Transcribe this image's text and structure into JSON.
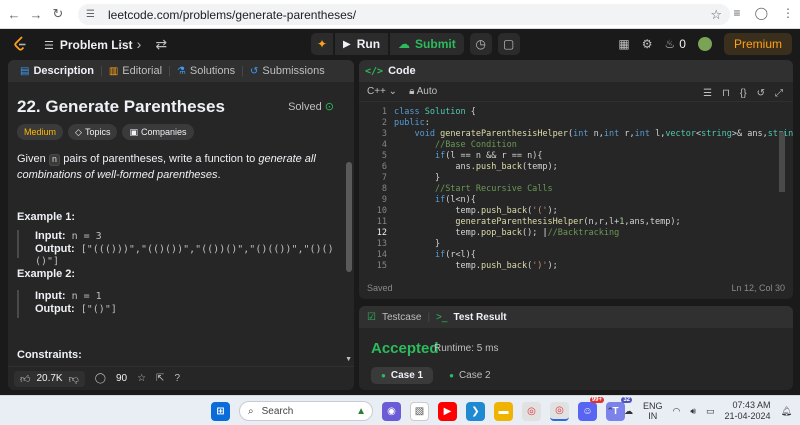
{
  "browser": {
    "url": "leetcode.com/problems/generate-parentheses/"
  },
  "topbar": {
    "problem_list": "Problem List",
    "run": "Run",
    "submit": "Submit",
    "coins": "0",
    "premium": "Premium"
  },
  "left": {
    "tabs": [
      "Description",
      "Editorial",
      "Solutions",
      "Submissions"
    ],
    "title": "22. Generate Parentheses",
    "solved": "Solved",
    "chips": [
      "Medium",
      "Topics",
      "Companies"
    ],
    "desc_pre": "Given ",
    "desc_code": "n",
    "desc_mid": " pairs of parentheses, write a function to ",
    "desc_em": "generate all combinations of well-formed parentheses",
    "desc_post": ".",
    "example1": {
      "heading": "Example 1:",
      "input_label": "Input:",
      "input_value": "n = 3",
      "output_label": "Output:",
      "output_value": "[\"((()))\",\"(()())\",\"(())()\",\"()(())\",\"()()()\"]"
    },
    "example2": {
      "heading": "Example 2:",
      "input_label": "Input:",
      "input_value": "n = 1",
      "output_label": "Output:",
      "output_value": "[\"()\"]"
    },
    "constraints": "Constraints:",
    "likes": "20.7K",
    "comments": "90"
  },
  "code": {
    "title": "Code",
    "language": "C++",
    "auto": "Auto",
    "status": "Saved",
    "cursor": "Ln 12, Col 30",
    "lines": [
      {
        "n": "1",
        "t": "class Solution {"
      },
      {
        "n": "2",
        "t": "public:"
      },
      {
        "n": "3",
        "t": "    void generateParenthesisHelper(int n,int r,int l,vector<string>& ans,string temp){"
      },
      {
        "n": "4",
        "t": "        //Base Condition"
      },
      {
        "n": "5",
        "t": "        if(l == n && r == n){"
      },
      {
        "n": "6",
        "t": "            ans.push_back(temp);"
      },
      {
        "n": "7",
        "t": "        }"
      },
      {
        "n": "8",
        "t": "        //Start Recursive Calls"
      },
      {
        "n": "9",
        "t": "        if(l<n){"
      },
      {
        "n": "10",
        "t": "            temp.push_back('(');"
      },
      {
        "n": "11",
        "t": "            generateParenthesisHelper(n,r,l+1,ans,temp);"
      },
      {
        "n": "12",
        "t": "            temp.pop_back(); //Backtracking"
      },
      {
        "n": "13",
        "t": "        }"
      },
      {
        "n": "14",
        "t": "        if(r<l){"
      },
      {
        "n": "15",
        "t": "            temp.push_back(')');"
      }
    ]
  },
  "test": {
    "tab_testcase": "Testcase",
    "tab_result": "Test Result",
    "verdict": "Accepted",
    "runtime": "Runtime: 5 ms",
    "cases": [
      "Case 1",
      "Case 2"
    ]
  },
  "taskbar": {
    "search": "Search",
    "lang1": "ENG",
    "lang2": "IN",
    "time": "07:43 AM",
    "date": "21-04-2024",
    "badge1": "99+",
    "badge2": "32"
  },
  "colors": {
    "accent_orange": "#ffa116",
    "green": "#2cbb5d",
    "medium": "#ffb800",
    "panel": "#262626",
    "bg": "#1a1a1a"
  }
}
